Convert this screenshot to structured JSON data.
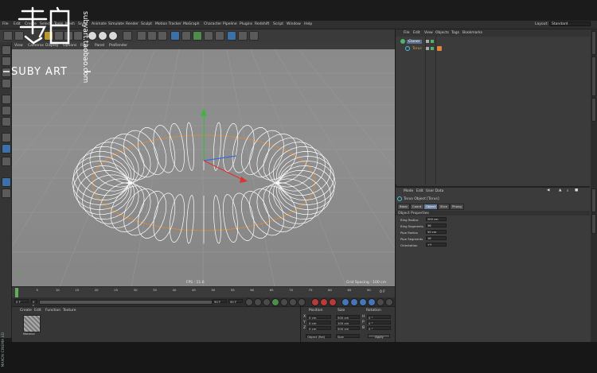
{
  "watermark": {
    "brand": "SUBY ART",
    "vertical_url": "subyart.taobao.com",
    "side_brand": "MAXON CINEMA 4D"
  },
  "main_menu": [
    "File",
    "Edit",
    "Create",
    "Select",
    "Tools",
    "Mesh",
    "Snap",
    "Animate",
    "Simulate",
    "Render",
    "Sculpt",
    "Motion Tracker",
    "MoGraph",
    "Character",
    "Pipeline",
    "Plugins",
    "Redshift",
    "Script",
    "Window",
    "Help"
  ],
  "layout": {
    "label": "Layout:",
    "value": "Standard"
  },
  "viewport": {
    "menu": [
      "View",
      "Cameras",
      "Display",
      "Options",
      "Filter",
      "Panel",
      "ProRender"
    ],
    "status": "FPS : 11.6",
    "grid_spacing": "Grid Spacing : 100 cm",
    "perspective": "Perspective"
  },
  "timeline": {
    "ticks": [
      "0",
      "5",
      "10",
      "15",
      "20",
      "25",
      "30",
      "35",
      "40",
      "45",
      "50",
      "55",
      "60",
      "65",
      "70",
      "75",
      "80",
      "85",
      "90"
    ],
    "start_frame": "0 F",
    "end_frame": "90 F",
    "current_frame": "0 F",
    "range_start": "0 F",
    "range_end": "90 F"
  },
  "materials": {
    "menu": [
      "Create",
      "Edit",
      "Function",
      "Texture"
    ],
    "swatch_label": "Material"
  },
  "coordinates": {
    "headers": [
      "Position",
      "Size",
      "Rotation"
    ],
    "rows": [
      {
        "axis": "X",
        "pos": "0 cm",
        "size": "500 cm",
        "rot_axis": "H",
        "rot": "0 °"
      },
      {
        "axis": "Y",
        "pos": "0 cm",
        "size": "100 cm",
        "rot_axis": "P",
        "rot": "0 °"
      },
      {
        "axis": "Z",
        "pos": "0 cm",
        "size": "500 cm",
        "rot_axis": "B",
        "rot": "0 °"
      }
    ],
    "mode": "Object (Rel)",
    "size_mode": "Size",
    "apply": "Apply"
  },
  "object_manager": {
    "menu": [
      "File",
      "Edit",
      "View",
      "Objects",
      "Tags",
      "Bookmarks"
    ],
    "objects": [
      {
        "name": "Cloner",
        "color": "#4fb36a"
      },
      {
        "name": "Torus",
        "color": "#e39f3b"
      }
    ]
  },
  "attribute_manager": {
    "menu": [
      "Mode",
      "Edit",
      "User Data"
    ],
    "title": "Torus Object [Torus]",
    "tabs": [
      "Basic",
      "Coord.",
      "Object",
      "Slice",
      "Phong"
    ],
    "active_tab": "Object",
    "section": "Object Properties",
    "props": [
      {
        "label": "Ring Radius",
        "value": "200 cm"
      },
      {
        "label": "Ring Segments",
        "value": "36"
      },
      {
        "label": "Pipe Radius",
        "value": "50 cm"
      },
      {
        "label": "Pipe Segments",
        "value": "18"
      },
      {
        "label": "Orientation",
        "value": "+Y"
      }
    ]
  },
  "right_tabs": [
    "Objects",
    "Content Browser",
    "Structure",
    "Attributes",
    "Layers"
  ],
  "colors": {
    "accent": "#6a7fa0",
    "wire": "#ffffff",
    "selection": "#e48a2a",
    "axis_y": "#3fb43f",
    "axis_x": "#d33",
    "axis_z": "#3a6bd8"
  }
}
